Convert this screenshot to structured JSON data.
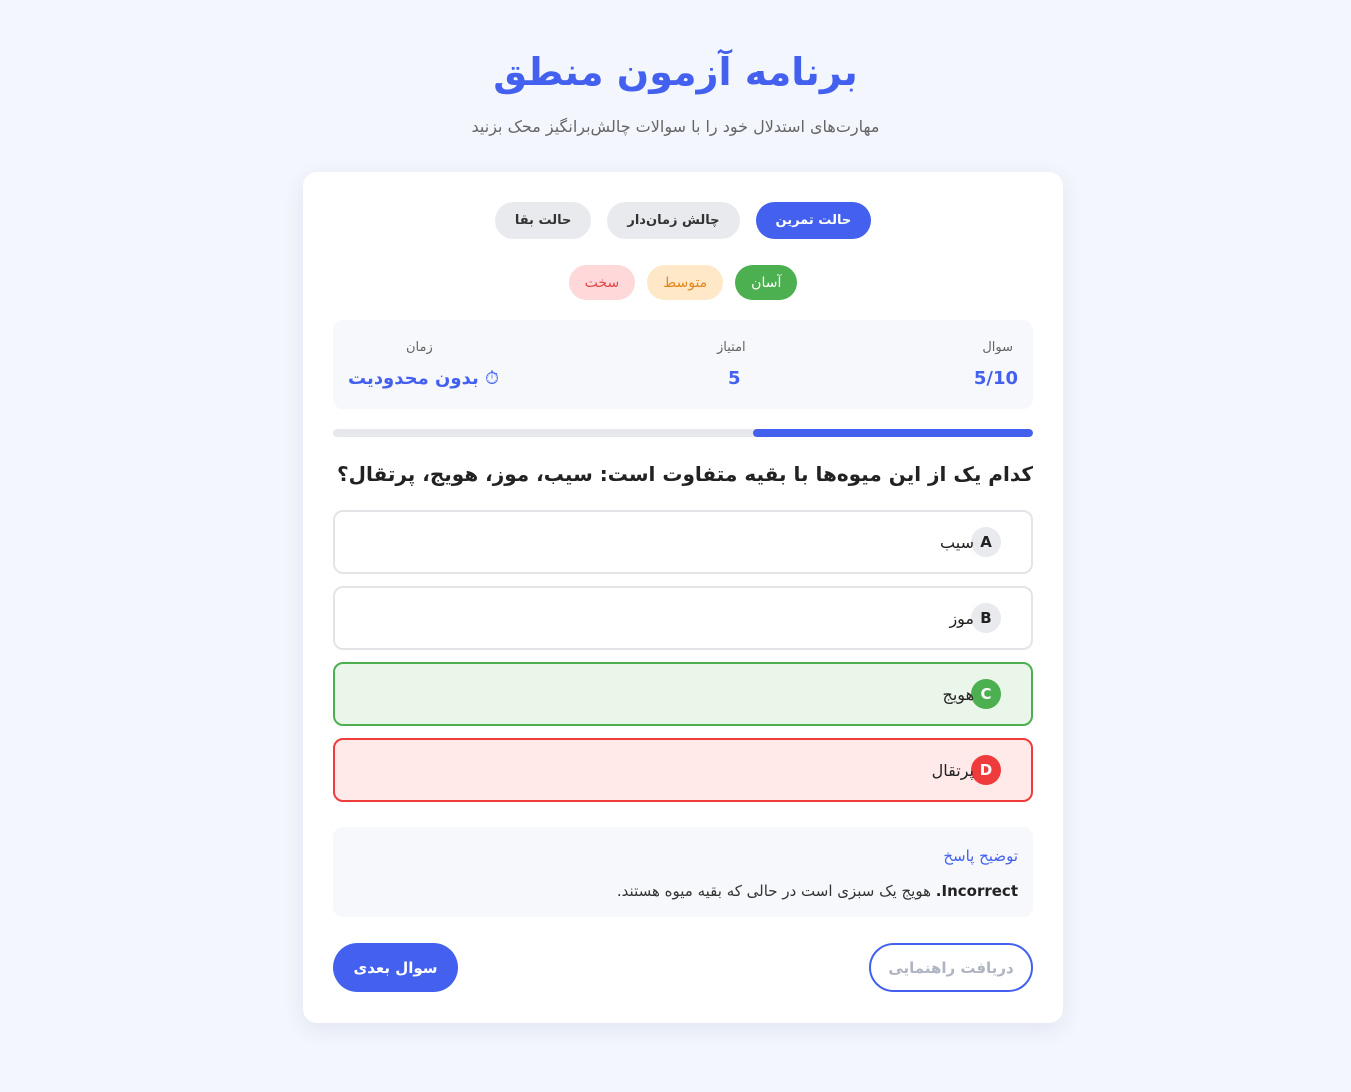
{
  "header": {
    "title": "برنامه آزمون منطق",
    "subtitle": "مهارت‌های استدلال خود را با سوالات چالش‌برانگیز محک بزنید"
  },
  "modes": [
    {
      "label": "حالت تمرین",
      "active": true
    },
    {
      "label": "چالش زمان‌دار",
      "active": false
    },
    {
      "label": "حالت بقا",
      "active": false
    }
  ],
  "levels": [
    {
      "label": "آسان",
      "active": true
    },
    {
      "label": "متوسط",
      "active": false
    },
    {
      "label": "سخت",
      "active": false
    }
  ],
  "stats": {
    "question_label": "سوال",
    "question_value": "5/10",
    "score_label": "امتیاز",
    "score_value": "5",
    "time_label": "زمان",
    "time_icon": "⏱",
    "time_value": "بدون محدودیت"
  },
  "progress": {
    "fraction": 0.4
  },
  "question": {
    "text": "کدام یک از این میوه‌ها با بقیه متفاوت است: سیب، موز، هویج، پرتقال؟",
    "options": [
      {
        "letter": "A",
        "text": "سیب",
        "state": "neutral"
      },
      {
        "letter": "B",
        "text": "موز",
        "state": "neutral"
      },
      {
        "letter": "C",
        "text": "هویج",
        "state": "correct"
      },
      {
        "letter": "D",
        "text": "پرتقال",
        "state": "wrong"
      }
    ]
  },
  "explanation": {
    "title": "توضیح پاسخ",
    "verdict": "Incorrect.",
    "text": " هویج یک سبزی است در حالی که بقیه میوه هستند."
  },
  "actions": {
    "hint_label": "دریافت راهنمایی",
    "next_label": "سوال بعدی"
  },
  "colors": {
    "accent": "#4361ee",
    "correct": "#4caf50",
    "wrong": "#ef3b3b",
    "background": "#f3f6fc"
  }
}
